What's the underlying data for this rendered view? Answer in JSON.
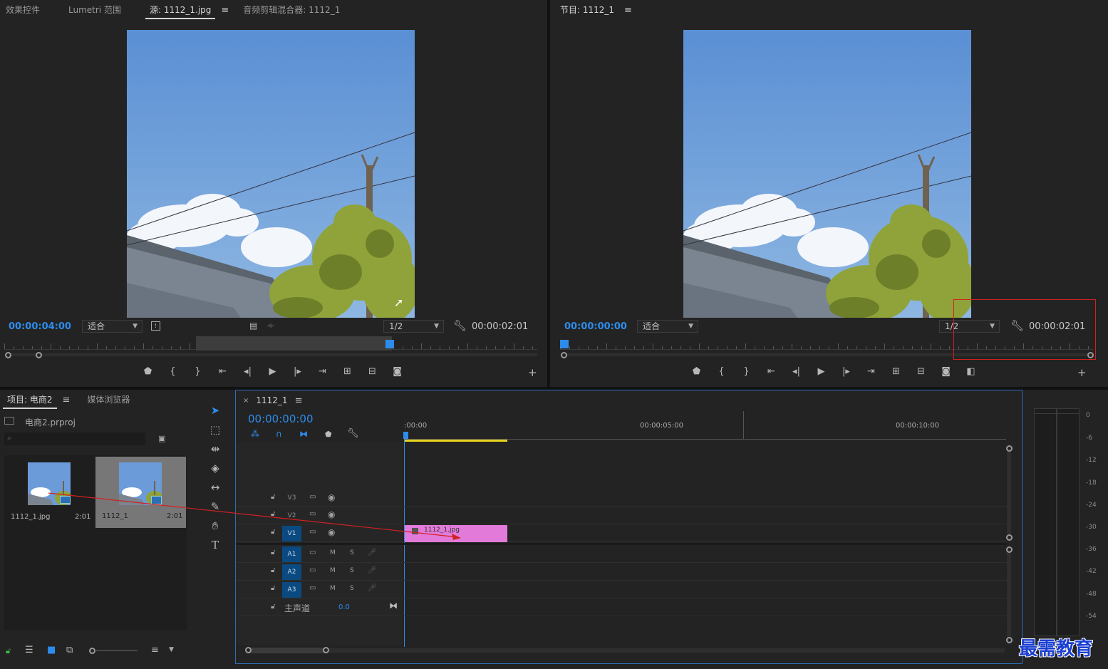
{
  "source_panel": {
    "tabs": [
      "效果控件",
      "Lumetri 范围",
      "源: 1112_1.jpg",
      "音频剪辑混合器: 1112_1"
    ],
    "active_tab_index": 2,
    "timecode_current": "00:00:04:00",
    "fit_label": "适合",
    "resolution_label": "1/2",
    "timecode_duration": "00:00:02:01"
  },
  "program_panel": {
    "tab": "节目: 1112_1",
    "timecode_current": "00:00:00:00",
    "fit_label": "适合",
    "resolution_label": "1/2",
    "timecode_duration": "00:00:02:01"
  },
  "project_panel": {
    "tabs": [
      "项目: 电商2",
      "媒体浏览器"
    ],
    "project_file": "电商2.prproj",
    "search_placeholder": "",
    "items": [
      {
        "name": "1112_1.jpg",
        "duration": "2:01"
      },
      {
        "name": "1112_1",
        "duration": "2:01"
      }
    ]
  },
  "timeline_panel": {
    "tab": "1112_1",
    "timecode": "00:00:00:00",
    "ruler_labels": [
      ":00:00",
      "00:00:05:00",
      "00:00:10:00"
    ],
    "tracks_video": [
      "V3",
      "V2",
      "V1"
    ],
    "tracks_audio": [
      "A1",
      "A2",
      "A3"
    ],
    "master_label": "主声道",
    "master_value": "0.0",
    "mute_label": "M",
    "solo_label": "S",
    "clip_name": "1112_1.jpg"
  },
  "audio_meter": {
    "labels": [
      "0",
      "-6",
      "-12",
      "-18",
      "-24",
      "-30",
      "-36",
      "-42",
      "-48",
      "-54"
    ]
  },
  "watermark": "最需教育",
  "colors": {
    "accent_blue": "#2d8ceb",
    "clip_pink": "#e27ad9",
    "annotation_red": "#d42020",
    "work_area_yellow": "#e8d21d"
  }
}
